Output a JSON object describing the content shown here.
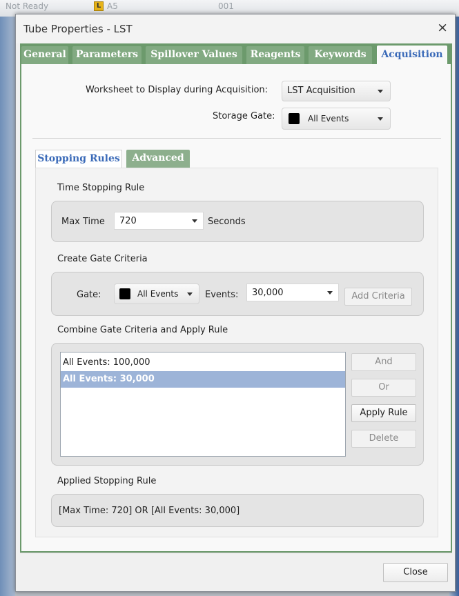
{
  "background": {
    "status_text": "Not Ready",
    "well_label": "A5",
    "number_text": "001"
  },
  "dialog": {
    "title": "Tube Properties - LST",
    "close_icon": "×",
    "close_button": "Close"
  },
  "tabs": [
    {
      "label": "General"
    },
    {
      "label": "Parameters"
    },
    {
      "label": "Spillover Values"
    },
    {
      "label": "Reagents"
    },
    {
      "label": "Keywords"
    },
    {
      "label": "Acquisition",
      "active": true
    }
  ],
  "acquisition": {
    "worksheet_label": "Worksheet to Display during Acquisition:",
    "worksheet_value": "LST Acquisition",
    "storage_gate_label": "Storage Gate:",
    "storage_gate_value": "All Events"
  },
  "subtabs": [
    {
      "label": "Stopping Rules",
      "active": true
    },
    {
      "label": "Advanced"
    }
  ],
  "time_rule": {
    "section_title": "Time Stopping Rule",
    "max_time_label": "Max Time",
    "max_time_value": "720",
    "unit_label": "Seconds"
  },
  "gate_criteria": {
    "section_title": "Create Gate Criteria",
    "gate_label": "Gate:",
    "gate_value": "All Events",
    "events_label": "Events:",
    "events_value": "30,000",
    "add_button": "Add Criteria"
  },
  "combine": {
    "section_title": "Combine Gate Criteria and Apply Rule",
    "items": [
      {
        "text": "All Events: 100,000",
        "selected": false
      },
      {
        "text": "All Events: 30,000",
        "selected": true
      }
    ],
    "buttons": {
      "and": "And",
      "or": "Or",
      "apply": "Apply Rule",
      "delete": "Delete"
    }
  },
  "applied": {
    "section_title": "Applied Stopping Rule",
    "rule_text": "[Max Time: 720] OR [All Events: 30,000]"
  },
  "colors": {
    "tab_strip": "#6c9a6c",
    "active_tab_text": "#3a6ab8",
    "selection": "#9db4d8",
    "gate_swatch": "#000000"
  }
}
